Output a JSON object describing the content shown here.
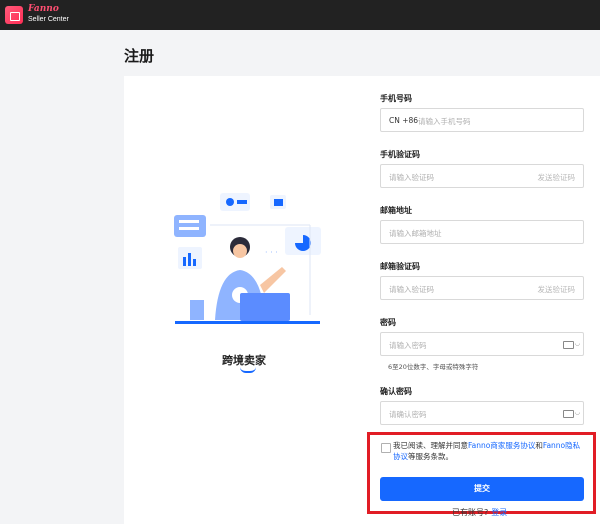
{
  "header": {
    "brand": "Fanno",
    "subtitle": "Seller Center"
  },
  "page": {
    "title": "注册"
  },
  "illustration": {
    "caption": "跨境卖家"
  },
  "form": {
    "phone": {
      "label": "手机号码",
      "prefix": "CN +86",
      "placeholder": "请输入手机号码"
    },
    "phone_code": {
      "label": "手机验证码",
      "placeholder": "请输入验证码",
      "action": "发送验证码"
    },
    "email": {
      "label": "邮箱地址",
      "placeholder": "请输入邮箱地址"
    },
    "email_code": {
      "label": "邮箱验证码",
      "placeholder": "请输入验证码",
      "action": "发送验证码"
    },
    "password": {
      "label": "密码",
      "placeholder": "请输入密码",
      "hint": "6至20位数字、字母或特殊字符"
    },
    "confirm": {
      "label": "确认密码",
      "placeholder": "请确认密码"
    },
    "agreement": {
      "prefix": "我已阅读、理解并同意",
      "link1": "Fanno商家服务协议",
      "mid": "和",
      "link2": "Fanno隐私协议",
      "suffix": "等服务条款。"
    },
    "submit_label": "提交",
    "login_prompt": "已有账号?",
    "login_link": "登录"
  },
  "colors": {
    "accent": "#1668ff",
    "highlight_box": "#e11d25",
    "topbar": "#222222"
  }
}
